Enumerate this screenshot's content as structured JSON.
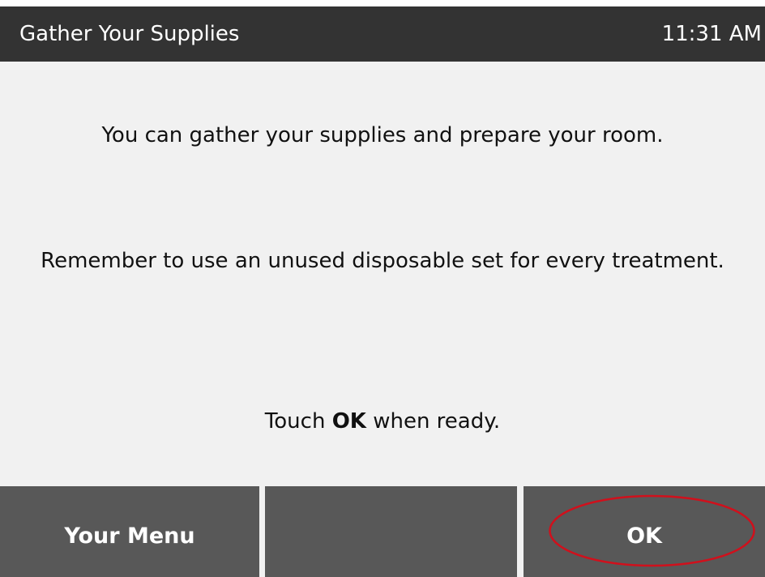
{
  "header": {
    "title": "Gather Your Supplies",
    "time": "11:31 AM"
  },
  "message": {
    "line1": "You can gather your supplies and prepare your room.",
    "line2": "Remember to use an unused disposable set for every treatment.",
    "line3_prefix": "Touch ",
    "line3_bold": "OK",
    "line3_suffix": " when ready."
  },
  "footer": {
    "left_label": "Your Menu",
    "middle_label": "",
    "right_label": "OK"
  },
  "colors": {
    "header_bg": "#333333",
    "content_bg": "#f1f1f1",
    "button_bg": "#585858",
    "highlight": "#d0101c"
  }
}
